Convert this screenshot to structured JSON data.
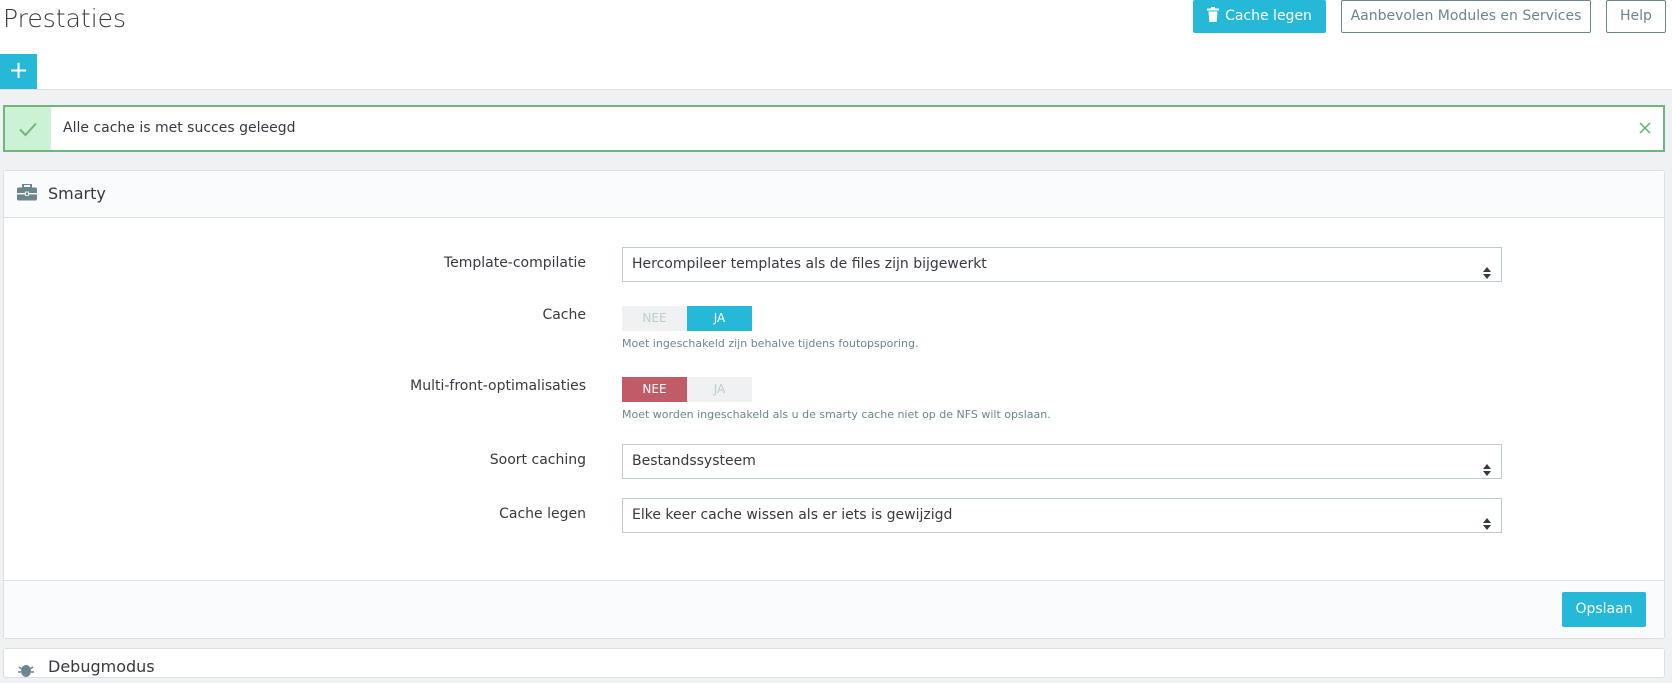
{
  "header": {
    "title": "Prestaties",
    "clear_cache_button": "Cache legen",
    "modules_button": "Aanbevolen Modules en Services",
    "help_button": "Help",
    "add_button": "+"
  },
  "alert": {
    "message": "Alle cache is met succes geleegd"
  },
  "smarty_panel": {
    "title": "Smarty",
    "fields": {
      "template_compilation": {
        "label": "Template-compilatie",
        "value": "Hercompileer templates als de files zijn bijgewerkt"
      },
      "cache": {
        "label": "Cache",
        "no": "NEE",
        "yes": "JA",
        "selected": "JA",
        "help": "Moet ingeschakeld zijn behalve tijdens foutopsporing."
      },
      "multi_front": {
        "label": "Multi-front-optimalisaties",
        "no": "NEE",
        "yes": "JA",
        "selected": "NEE",
        "help": "Moet worden ingeschakeld als u de smarty cache niet op de NFS wilt opslaan."
      },
      "caching_type": {
        "label": "Soort caching",
        "value": "Bestandssysteem"
      },
      "clear_cache": {
        "label": "Cache legen",
        "value": "Elke keer cache wissen als er iets is gewijzigd"
      }
    },
    "save_button": "Opslaan"
  },
  "next_panel": {
    "title": "Debugmodus"
  },
  "colors": {
    "primary": "#25b9d7",
    "success_border": "#70b580",
    "danger": "#c05c67"
  }
}
